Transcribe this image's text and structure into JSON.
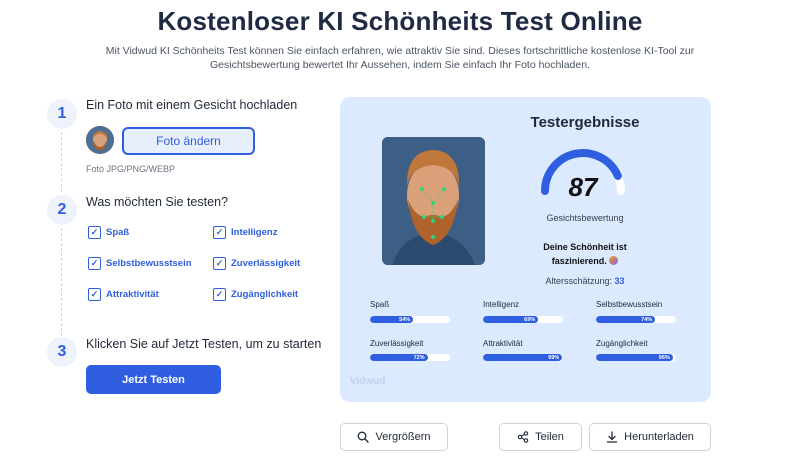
{
  "header": {
    "title": "Kostenloser KI Schönheits Test Online",
    "subtitle": "Mit Vidwud KI Schönheits Test können Sie einfach erfahren, wie attraktiv Sie sind. Dieses fortschrittliche kostenlose KI-Tool zur Gesichtsbewertung bewertet Ihr Aussehen, indem Sie einfach Ihr Foto hochladen."
  },
  "steps": [
    {
      "num": "1",
      "title": "Ein Foto mit einem Gesicht hochladen"
    },
    {
      "num": "2",
      "title": "Was möchten Sie testen?"
    },
    {
      "num": "3",
      "title": "Klicken Sie auf Jetzt Testen, um zu starten"
    }
  ],
  "upload": {
    "change_label": "Foto ändern",
    "formats": "Foto JPG/PNG/WEBP"
  },
  "options": [
    "Spaß",
    "Intelligenz",
    "Selbstbewusstsein",
    "Zuverlässigkeit",
    "Attraktivität",
    "Zugänglichkeit"
  ],
  "start_label": "Jetzt Testen",
  "results": {
    "title": "Testergebnisse",
    "score": "87",
    "score_fraction": 0.87,
    "score_label": "Gesichtsbewertung",
    "beauty_line1": "Deine Schönheit ist",
    "beauty_line2": "faszinierend.",
    "age_label": "Altersschätzung:",
    "age_value": "33",
    "watermark": "Vidwud",
    "metrics": [
      {
        "label": "Spaß",
        "value": "54%",
        "fraction": 0.54
      },
      {
        "label": "Intelligenz",
        "value": "69%",
        "fraction": 0.69
      },
      {
        "label": "Selbstbewusstsein",
        "value": "74%",
        "fraction": 0.74
      },
      {
        "label": "Zuverlässigkeit",
        "value": "72%",
        "fraction": 0.72
      },
      {
        "label": "Attraktivität",
        "value": "99%",
        "fraction": 0.99
      },
      {
        "label": "Zugänglichkeit",
        "value": "96%",
        "fraction": 0.96
      }
    ]
  },
  "actions": {
    "zoom": "Vergrößern",
    "share": "Teilen",
    "download": "Herunterladen"
  },
  "colors": {
    "accent": "#2f5fe0",
    "card": "#dbeafe"
  },
  "icons": {
    "zoom": "search-icon",
    "share": "share-icon",
    "download": "download-icon",
    "check": "check-icon"
  }
}
